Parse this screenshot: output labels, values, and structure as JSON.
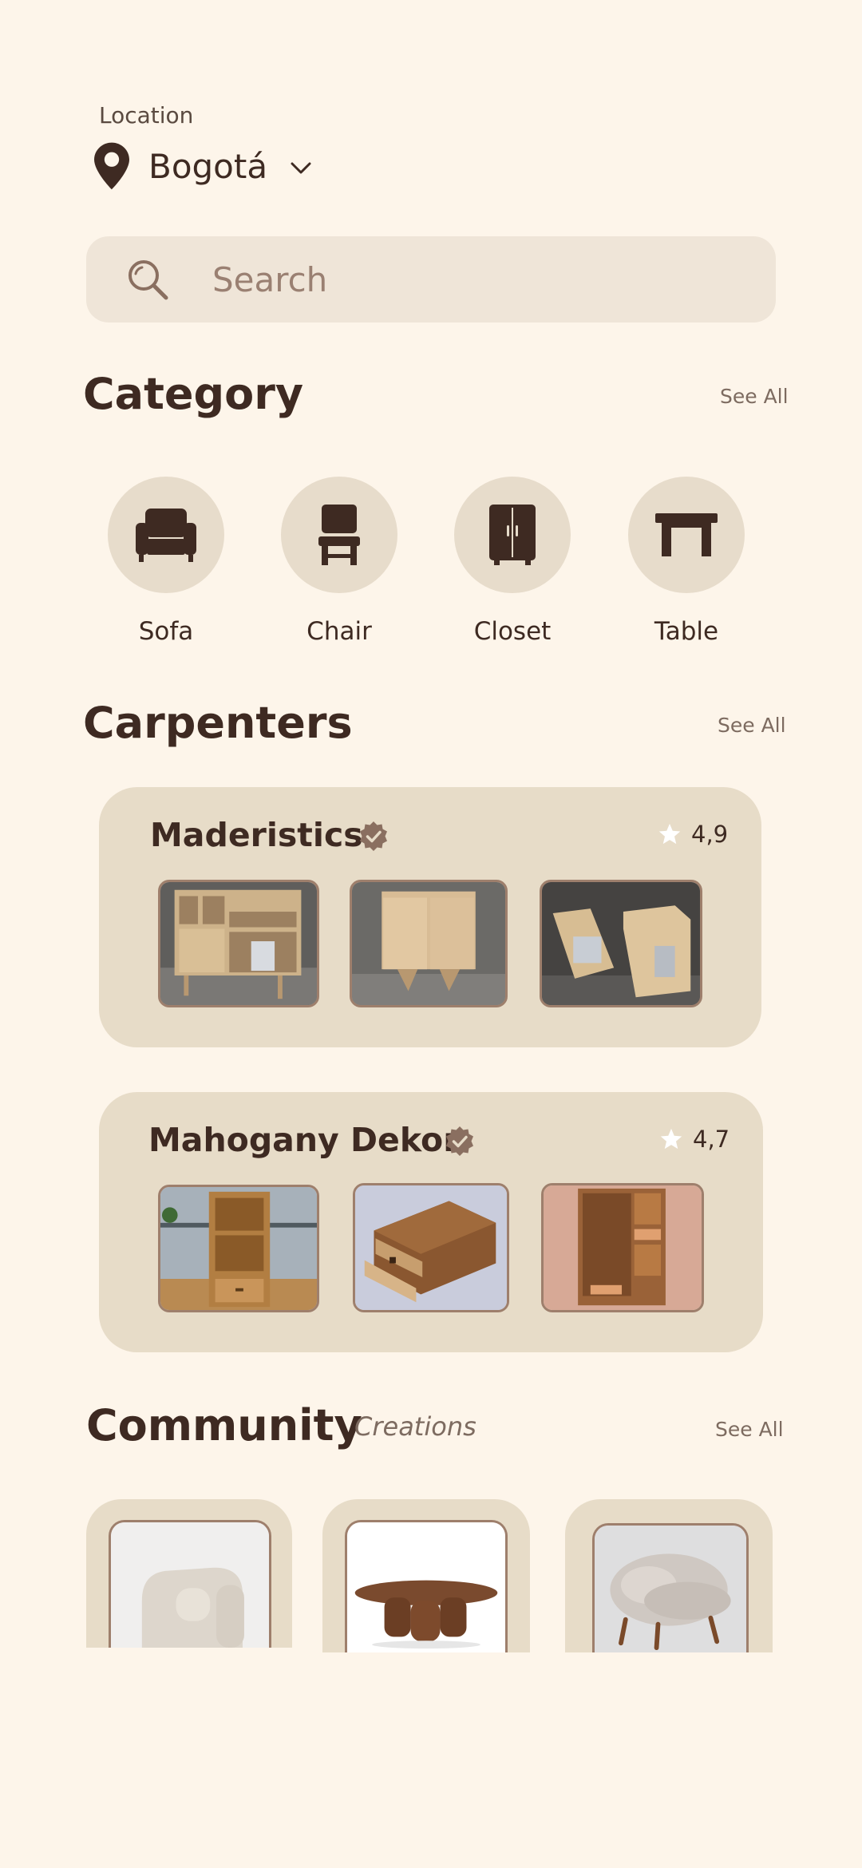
{
  "location": {
    "label": "Location",
    "city": "Bogotá"
  },
  "search": {
    "placeholder": "Search"
  },
  "category": {
    "title": "Category",
    "see_all": "See All",
    "items": [
      {
        "label": "Sofa",
        "icon": "sofa-icon"
      },
      {
        "label": "Chair",
        "icon": "chair-icon"
      },
      {
        "label": "Closet",
        "icon": "closet-icon"
      },
      {
        "label": "Table",
        "icon": "table-icon"
      }
    ]
  },
  "carpenters": {
    "title": "Carpenters",
    "see_all": "See All",
    "items": [
      {
        "name": "Maderistics",
        "rating": "4,9",
        "verified": true
      },
      {
        "name": "Mahogany Dekor",
        "rating": "4,7",
        "verified": true
      }
    ]
  },
  "community": {
    "title": "Community",
    "subtitle": "Creations",
    "see_all": "See All"
  },
  "colors": {
    "background": "#fdf5ea",
    "accent_dark": "#3e2a22",
    "card": "#e7dcc8",
    "verified_badge": "#8a6f60"
  }
}
